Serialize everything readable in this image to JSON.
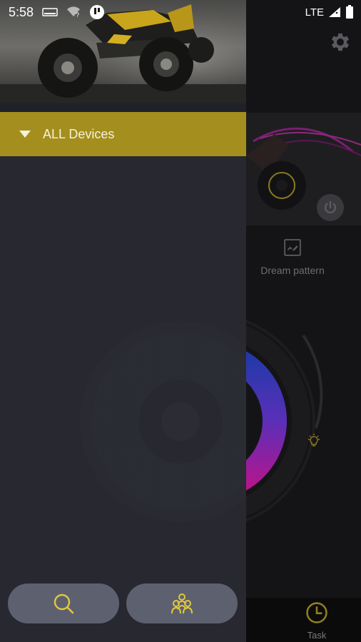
{
  "status_bar": {
    "time": "5:58",
    "network": "LTE"
  },
  "drawer": {
    "header_image": "atv-quad-racing-photo",
    "devices_section": {
      "label": "ALL Devices",
      "state": "collapsed"
    },
    "bottom_buttons": [
      {
        "name": "search",
        "icon": "search-icon"
      },
      {
        "name": "group",
        "icon": "group-icon"
      }
    ],
    "accent_color": "#a48f1e"
  },
  "background_app": {
    "dream_pattern_label": "Dream pattern",
    "task_label": "Task",
    "icon_color": "#d6c03a"
  }
}
